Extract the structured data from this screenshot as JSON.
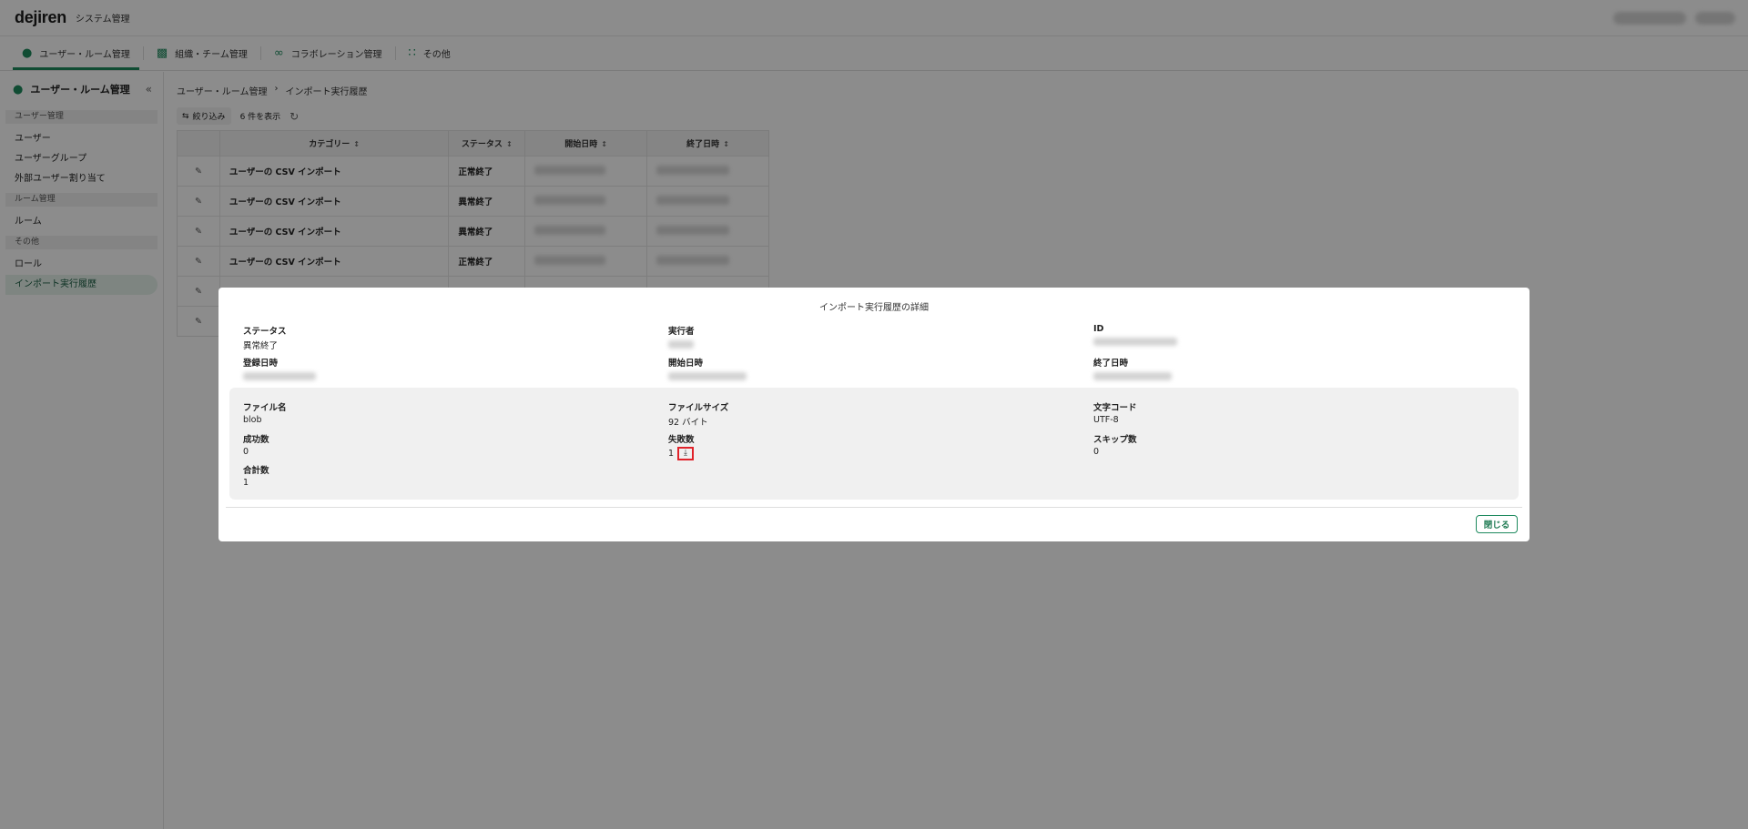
{
  "app": {
    "logo": "dejiren",
    "system_name": "システム管理"
  },
  "nav_tabs": [
    {
      "label": "ユーザー・ルーム管理",
      "icon": "user-icon",
      "active": true
    },
    {
      "label": "組織・チーム管理",
      "icon": "building-icon",
      "active": false
    },
    {
      "label": "コラボレーション管理",
      "icon": "link-icon",
      "active": false
    },
    {
      "label": "その他",
      "icon": "grid-icon",
      "active": false
    }
  ],
  "sidebar": {
    "title": "ユーザー・ルーム管理",
    "sections": [
      {
        "label": "ユーザー管理",
        "items": [
          "ユーザー",
          "ユーザーグループ",
          "外部ユーザー割り当て"
        ]
      },
      {
        "label": "ルーム管理",
        "items": [
          "ルーム"
        ]
      },
      {
        "label": "その他",
        "items": [
          "ロール",
          "インポート実行履歴"
        ]
      }
    ],
    "active_item": "インポート実行履歴"
  },
  "breadcrumb": {
    "parent": "ユーザー・ルーム管理",
    "separator": "›",
    "current": "インポート実行履歴"
  },
  "toolbar": {
    "filter_label": "絞り込み",
    "count_label": "6 件を表示"
  },
  "table": {
    "headers": [
      "カテゴリー",
      "ステータス",
      "開始日時",
      "終了日時"
    ],
    "rows": [
      {
        "category": "ユーザーの CSV インポート",
        "status": "正常終了"
      },
      {
        "category": "ユーザーの CSV インポート",
        "status": "異常終了"
      },
      {
        "category": "ユーザーの CSV インポート",
        "status": "異常終了"
      },
      {
        "category": "ユーザーの CSV インポート",
        "status": "正常終了"
      }
    ]
  },
  "modal": {
    "title": "インポート実行履歴の詳細",
    "status_label": "ステータス",
    "status_value": "異常終了",
    "executor_label": "実行者",
    "id_label": "ID",
    "registered_label": "登録日時",
    "start_label": "開始日時",
    "end_label": "終了日時",
    "file_name_label": "ファイル名",
    "file_name_value": "blob",
    "file_size_label": "ファイルサイズ",
    "file_size_value": "92 バイト",
    "charset_label": "文字コード",
    "charset_value": "UTF-8",
    "success_label": "成功数",
    "success_value": "0",
    "failure_label": "失敗数",
    "failure_value": "1",
    "skip_label": "スキップ数",
    "skip_value": "0",
    "total_label": "合計数",
    "total_value": "1",
    "close_label": "閉じる"
  }
}
